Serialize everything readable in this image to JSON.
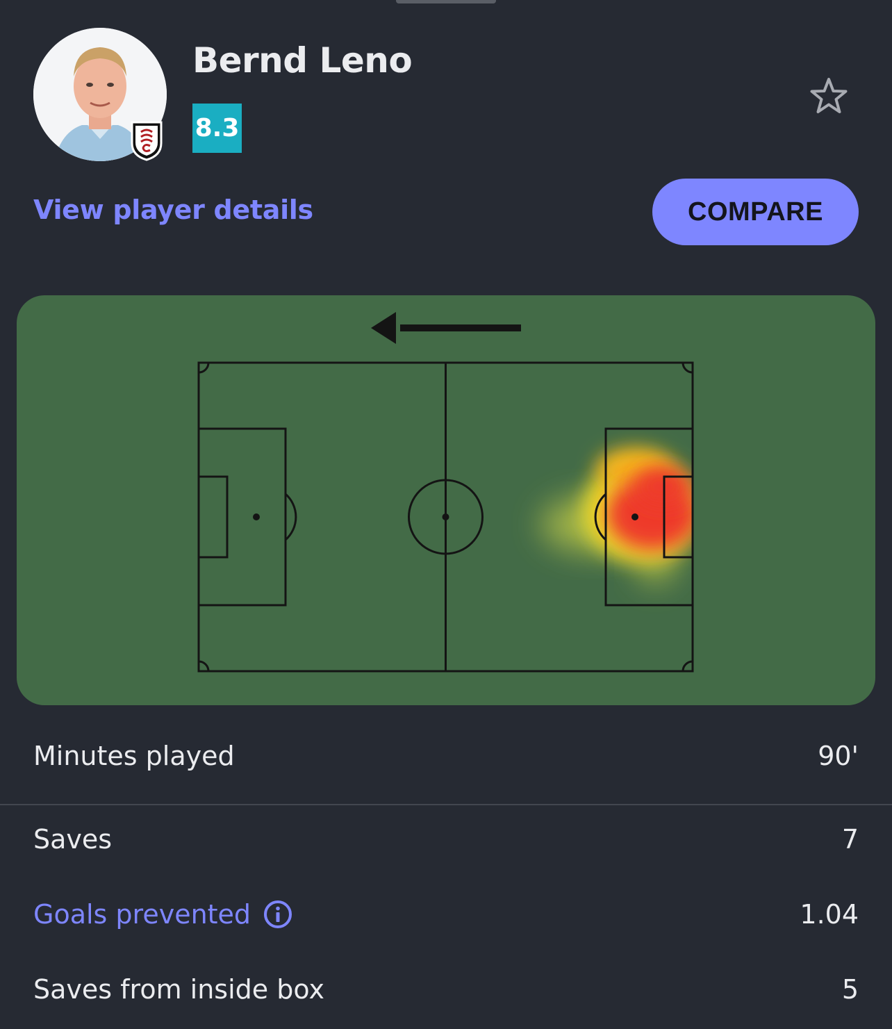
{
  "player": {
    "name": "Bernd Leno",
    "rating": "8.3",
    "club_badge_icon": "fulham-crest-icon",
    "photo_icon": "player-photo"
  },
  "actions": {
    "details_link": "View player details",
    "compare_button": "COMPARE",
    "favorite_icon": "star-outline-icon"
  },
  "heatmap": {
    "direction_icon": "arrow-left-icon",
    "pitch_color": "#436b47"
  },
  "stats": {
    "minutes": {
      "label": "Minutes played",
      "value": "90'"
    },
    "saves": {
      "label": "Saves",
      "value": "7"
    },
    "goals_prevented": {
      "label": "Goals prevented",
      "value": "1.04",
      "icon": "info-icon"
    },
    "saves_inside_box": {
      "label": "Saves from inside box",
      "value": "5"
    }
  },
  "colors": {
    "background": "#262a33",
    "accent": "#7e86ff",
    "rating_bg": "#1aaec2"
  }
}
